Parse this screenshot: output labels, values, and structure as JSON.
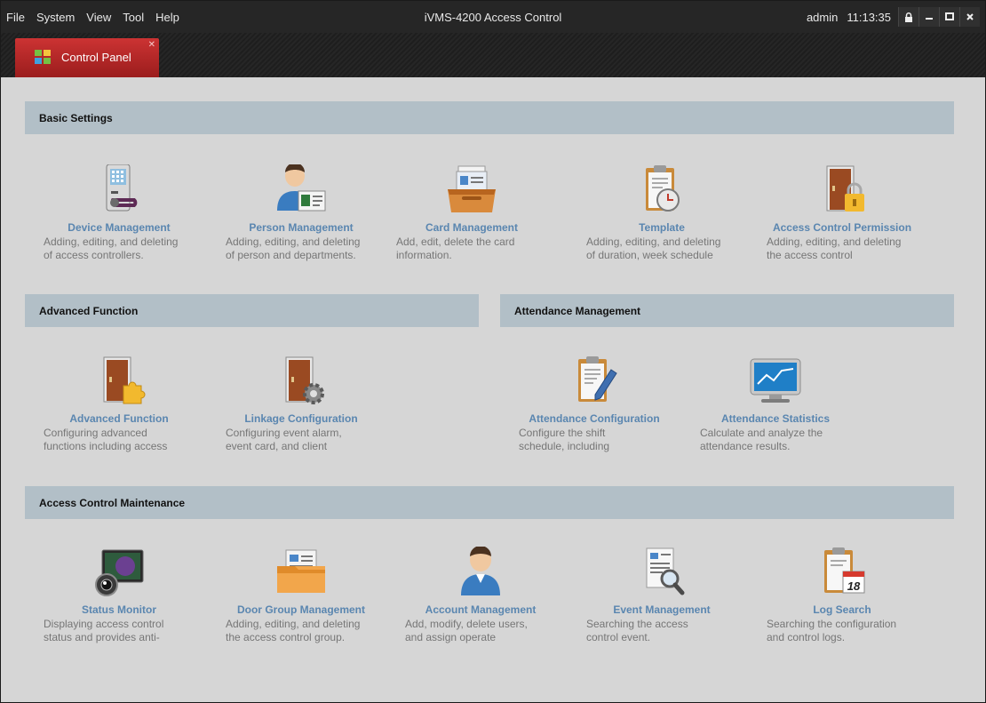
{
  "window": {
    "menu": [
      "File",
      "System",
      "View",
      "Tool",
      "Help"
    ],
    "title": "iVMS-4200 Access Control",
    "user": "admin",
    "time": "11:13:35"
  },
  "tab": {
    "label": "Control Panel"
  },
  "sections": {
    "basic": "Basic Settings",
    "advanced": "Advanced Function",
    "attendance": "Attendance Management",
    "maintenance": "Access Control Maintenance"
  },
  "items": {
    "device": {
      "title": "Device Management",
      "desc": [
        "Adding, editing, and deleting",
        "of access controllers."
      ]
    },
    "person": {
      "title": "Person Management",
      "desc": [
        "Adding, editing, and deleting",
        "of person and departments."
      ]
    },
    "card": {
      "title": "Card Management",
      "desc": [
        "Add, edit, delete the card",
        "information."
      ]
    },
    "template": {
      "title": "Template",
      "desc": [
        "Adding, editing, and deleting",
        "of duration, week schedule"
      ]
    },
    "permission": {
      "title": "Access Control Permission",
      "desc": [
        "Adding, editing, and deleting",
        "the access control"
      ]
    },
    "advfunc": {
      "title": "Advanced Function",
      "desc": [
        "Configuring advanced",
        "functions including access"
      ]
    },
    "linkage": {
      "title": "Linkage Configuration",
      "desc": [
        "Configuring event alarm,",
        "event card, and client"
      ]
    },
    "attconfig": {
      "title": "Attendance Configuration",
      "desc": [
        "Configure the shift",
        "schedule, including"
      ]
    },
    "attstats": {
      "title": "Attendance Statistics",
      "desc": [
        "Calculate and analyze the",
        "attendance results."
      ]
    },
    "status": {
      "title": "Status Monitor",
      "desc": [
        "Displaying access control",
        "status and provides anti-"
      ]
    },
    "doorgroup": {
      "title": "Door Group Management",
      "desc": [
        "Adding, editing, and deleting",
        "the access control group."
      ]
    },
    "account": {
      "title": "Account Management",
      "desc": [
        "Add, modify, delete users,",
        "and assign operate"
      ]
    },
    "event": {
      "title": "Event Management",
      "desc": [
        "Searching the access",
        "control event."
      ]
    },
    "logsearch": {
      "title": "Log Search",
      "desc": [
        "Searching the configuration",
        "and control logs."
      ],
      "calendar_day": "18"
    }
  }
}
